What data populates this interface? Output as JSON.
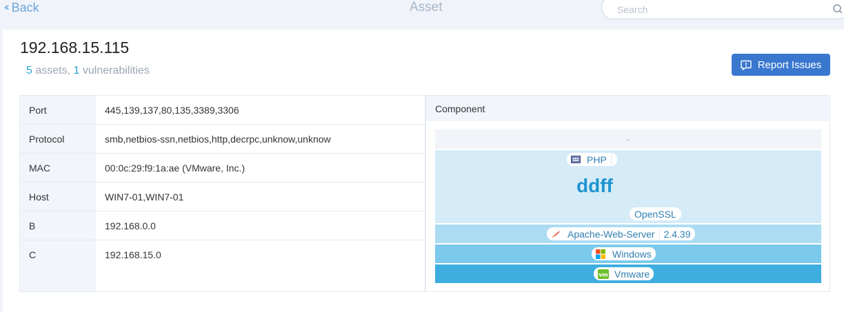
{
  "header": {
    "back_label": "Back",
    "title": "Asset",
    "search_placeholder": "Search"
  },
  "asset": {
    "ip": "192.168.15.115",
    "assets_count": "5",
    "assets_label": " assets, ",
    "vuln_count": "1",
    "vuln_label": " vulnerabilities"
  },
  "report_button": {
    "label": "Report Issues"
  },
  "info_rows": [
    {
      "key": "Port",
      "value": "445,139,137,80,135,3389,3306"
    },
    {
      "key": "Protocol",
      "value": "smb,netbios-ssn,netbios,http,decrpc,unknow,unknow"
    },
    {
      "key": "MAC",
      "value": "00:0c:29:f9:1a:ae (VMware, Inc.)"
    },
    {
      "key": "Host",
      "value": "WIN7-01,WIN7-01"
    },
    {
      "key": "B",
      "value": "192.168.0.0"
    },
    {
      "key": "C",
      "value": "192.168.15.0"
    }
  ],
  "component": {
    "header": "Component",
    "top_layer": "-",
    "app_layer": {
      "php": {
        "name": "PHP",
        "icon": "php-icon"
      },
      "center_text": "ddff",
      "openssl": {
        "name": "OpenSSL"
      }
    },
    "apache": {
      "name": "Apache-Web-Server",
      "version": "2.4.39",
      "icon": "feather-icon"
    },
    "windows": {
      "name": "Windows",
      "icon": "windows-icon"
    },
    "vmware": {
      "name": "Vmware",
      "icon": "vm-icon"
    }
  },
  "colors": {
    "accent": "#3a78d0",
    "link": "#6ea4d8",
    "count": "#27a3cc",
    "layer_app": "#d5ecf8",
    "layer_apache": "#acdcf2",
    "layer_windows": "#7bcaec",
    "layer_vmware": "#3daedf"
  }
}
